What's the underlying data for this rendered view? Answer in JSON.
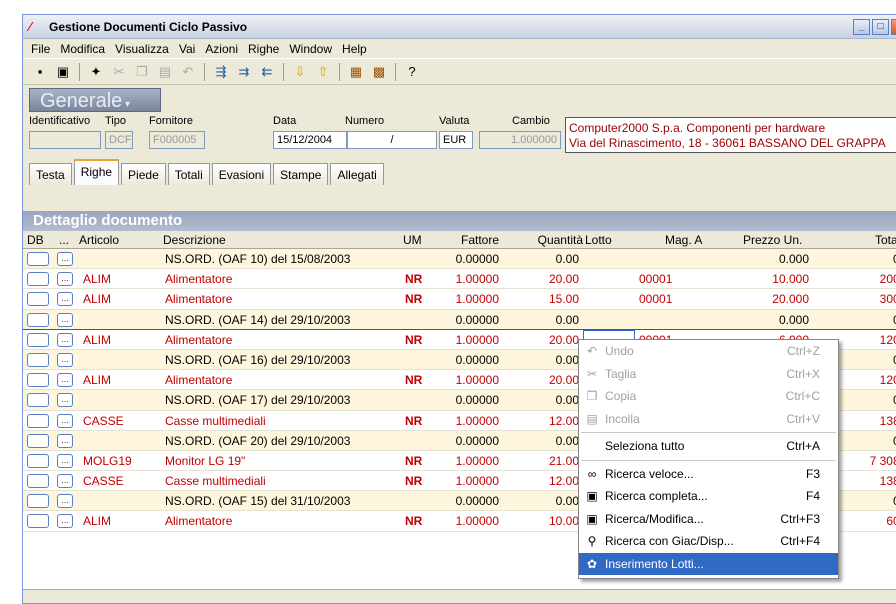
{
  "window": {
    "title": "Gestione Documenti Ciclo Passivo"
  },
  "menu": [
    "File",
    "Modifica",
    "Visualizza",
    "Vai",
    "Azioni",
    "Righe",
    "Window",
    "Help"
  ],
  "generale_button": "Generale",
  "header": {
    "labels": {
      "identificativo": "Identificativo",
      "tipo": "Tipo",
      "fornitore": "Fornitore",
      "data": "Data",
      "numero": "Numero",
      "valuta": "Valuta",
      "cambio": "Cambio"
    },
    "tipo": "DCF",
    "fornitore": "F000005",
    "data": "15/12/2004",
    "numero": "/",
    "valuta": "EUR",
    "cambio": "1.000000",
    "supplier_line1": "Computer2000 S.p.a. Componenti per hardware",
    "supplier_line2": "Via del Rinascimento, 18 - 36061 BASSANO DEL GRAPPA"
  },
  "tabs": [
    "Testa",
    "Righe",
    "Piede",
    "Totali",
    "Evasioni",
    "Stampe",
    "Allegati"
  ],
  "active_tab": "Righe",
  "detail_title": "Dettaglio documento",
  "columns": {
    "db": "DB",
    "dots": "...",
    "articolo": "Articolo",
    "descrizione": "Descrizione",
    "um": "UM",
    "fattore": "Fattore",
    "quantita": "Quantità",
    "lotto": "Lotto",
    "mag": "Mag. A",
    "prezzo": "Prezzo Un.",
    "totale": "Tota"
  },
  "rows": [
    {
      "ord": true,
      "articolo": "",
      "descrizione": "NS.ORD.  (OAF 10) del 15/08/2003",
      "um": "",
      "fattore": "0.00000",
      "quantita": "0.00",
      "mag": "",
      "prezzo": "0.000",
      "totale": "0."
    },
    {
      "ord": false,
      "articolo": "ALIM",
      "descrizione": "Alimentatore",
      "um": "NR",
      "fattore": "1.00000",
      "quantita": "20.00",
      "mag": "00001",
      "prezzo": "10.000",
      "totale": "200."
    },
    {
      "ord": false,
      "articolo": "ALIM",
      "descrizione": "Alimentatore",
      "um": "NR",
      "fattore": "1.00000",
      "quantita": "15.00",
      "mag": "00001",
      "prezzo": "20.000",
      "totale": "300."
    },
    {
      "ord": true,
      "articolo": "",
      "descrizione": "NS.ORD.  (OAF 14) del 29/10/2003",
      "um": "",
      "fattore": "0.00000",
      "quantita": "0.00",
      "mag": "",
      "prezzo": "0.000",
      "totale": "0."
    },
    {
      "ord": false,
      "articolo": "ALIM",
      "descrizione": "Alimentatore",
      "um": "NR",
      "fattore": "1.00000",
      "quantita": "20.00",
      "mag": "00001",
      "prezzo": "6.000",
      "totale": "120."
    },
    {
      "ord": true,
      "articolo": "",
      "descrizione": "NS.ORD.  (OAF 16) del 29/10/2003",
      "um": "",
      "fattore": "0.00000",
      "quantita": "0.00",
      "mag": "",
      "prezzo": "",
      "totale": "0."
    },
    {
      "ord": false,
      "articolo": "ALIM",
      "descrizione": "Alimentatore",
      "um": "NR",
      "fattore": "1.00000",
      "quantita": "20.00",
      "mag": "",
      "prezzo": "",
      "totale": "120."
    },
    {
      "ord": true,
      "articolo": "",
      "descrizione": "NS.ORD.  (OAF 17) del 29/10/2003",
      "um": "",
      "fattore": "0.00000",
      "quantita": "0.00",
      "mag": "",
      "prezzo": "",
      "totale": "0."
    },
    {
      "ord": false,
      "articolo": "CASSE",
      "descrizione": "Casse multimediali",
      "um": "NR",
      "fattore": "1.00000",
      "quantita": "12.00",
      "mag": "",
      "prezzo": "",
      "totale": "138."
    },
    {
      "ord": true,
      "articolo": "",
      "descrizione": "NS.ORD.  (OAF 20) del 29/10/2003",
      "um": "",
      "fattore": "0.00000",
      "quantita": "0.00",
      "mag": "",
      "prezzo": "",
      "totale": "0."
    },
    {
      "ord": false,
      "articolo": "MOLG19",
      "descrizione": "Monitor LG 19\"",
      "um": "NR",
      "fattore": "1.00000",
      "quantita": "21.00",
      "mag": "",
      "prezzo": "",
      "totale": "7 308."
    },
    {
      "ord": false,
      "articolo": "CASSE",
      "descrizione": "Casse multimediali",
      "um": "NR",
      "fattore": "1.00000",
      "quantita": "12.00",
      "mag": "",
      "prezzo": "",
      "totale": "138."
    },
    {
      "ord": true,
      "articolo": "",
      "descrizione": "NS.ORD.  (OAF 15) del 31/10/2003",
      "um": "",
      "fattore": "0.00000",
      "quantita": "0.00",
      "mag": "",
      "prezzo": "",
      "totale": "0."
    },
    {
      "ord": false,
      "articolo": "ALIM",
      "descrizione": "Alimentatore",
      "um": "NR",
      "fattore": "1.00000",
      "quantita": "10.00",
      "mag": "",
      "prezzo": "",
      "totale": "60."
    }
  ],
  "context_menu": [
    {
      "label": "Undo",
      "shortcut": "Ctrl+Z",
      "disabled": true,
      "icon": "undo-icon"
    },
    {
      "label": "Taglia",
      "shortcut": "Ctrl+X",
      "disabled": true,
      "icon": "cut-icon"
    },
    {
      "label": "Copia",
      "shortcut": "Ctrl+C",
      "disabled": true,
      "icon": "copy-icon"
    },
    {
      "label": "Incolla",
      "shortcut": "Ctrl+V",
      "disabled": true,
      "icon": "paste-icon"
    },
    {
      "label": "Seleziona tutto",
      "shortcut": "Ctrl+A",
      "disabled": false,
      "icon": ""
    },
    {
      "label": "Ricerca veloce...",
      "shortcut": "F3",
      "disabled": false,
      "icon": "binoculars-icon"
    },
    {
      "label": "Ricerca completa...",
      "shortcut": "F4",
      "disabled": false,
      "icon": "search-window-icon"
    },
    {
      "label": "Ricerca/Modifica...",
      "shortcut": "Ctrl+F3",
      "disabled": false,
      "icon": "search-edit-icon"
    },
    {
      "label": "Ricerca con Giac/Disp...",
      "shortcut": "Ctrl+F4",
      "disabled": false,
      "icon": "search-stock-icon"
    },
    {
      "label": "Inserimento Lotti...",
      "shortcut": "",
      "disabled": false,
      "icon": "lots-icon",
      "selected": true
    }
  ]
}
